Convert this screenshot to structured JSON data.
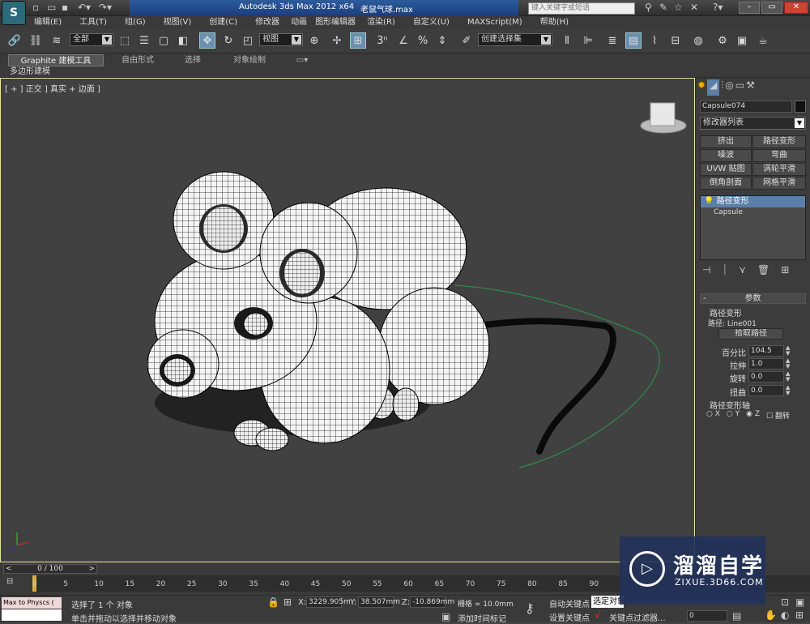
{
  "title": {
    "app": "Autodesk 3ds Max  2012 x64",
    "file": "老鼠气球.max",
    "search_placeholder": "键入关键字或短语"
  },
  "menu": [
    "编辑(E)",
    "工具(T)",
    "组(G)",
    "视图(V)",
    "创建(C)",
    "修改器",
    "动画",
    "图形编辑器",
    "渲染(R)",
    "自定义(U)",
    "MAXScript(M)",
    "帮助(H)"
  ],
  "toolbar": {
    "selection_filter": "全部",
    "ref_coord": "视图",
    "named_sel": "创建选择集",
    "snap_3": "3",
    "percent": "%"
  },
  "ribbon": {
    "tabs": [
      "Graphite 建模工具",
      "自由形式",
      "选择",
      "对象绘制"
    ],
    "sub": "多边形建模"
  },
  "viewport": {
    "label": "[ + ] 正交 ] 真实 + 边面 ]"
  },
  "panel": {
    "object_name": "Capsule074",
    "modifier_list": "修改器列表",
    "mod_buttons": [
      "挤出",
      "路径变形",
      "噪波",
      "弯曲",
      "UVW 贴图",
      "涡轮平滑",
      "倒角剖面",
      "网格平滑"
    ],
    "stack": [
      "路径变形",
      "Capsule"
    ],
    "rollout_title": "参数",
    "group1": "路径变形",
    "path_label": "路径: Line001",
    "pick_path": "拾取路径",
    "params": [
      {
        "label": "百分比",
        "value": "104.5"
      },
      {
        "label": "拉伸",
        "value": "1.0"
      },
      {
        "label": "旋转",
        "value": "0.0"
      },
      {
        "label": "扭曲",
        "value": "0.0"
      }
    ],
    "group2": "路径变形轴",
    "axes": [
      "X",
      "Y",
      "Z"
    ],
    "flip": "翻转"
  },
  "timeline": {
    "frame": "0 / 100",
    "ticks": [
      "0",
      "5",
      "10",
      "15",
      "20",
      "25",
      "30",
      "35",
      "40",
      "45",
      "50",
      "55",
      "60",
      "65",
      "70",
      "75",
      "80",
      "85",
      "90"
    ]
  },
  "status": {
    "script": "Max to Physcs (",
    "selected": "选择了 1 个 对象",
    "hint": "单击并拖动以选择并移动对象",
    "x": "3229.905m",
    "y": "38.507mm",
    "z": "-10.869mm",
    "grid": "栅格 = 10.0mm",
    "add_tag": "添加时间标记",
    "auto_key": "自动关键点",
    "set_key": "设置关键点",
    "sel_obj": "选定对象",
    "key_filter": "关键点过滤器...",
    "frame_field": "0"
  },
  "watermark": {
    "cn": "溜溜自学",
    "url": "ZIXUE.3D66.COM"
  },
  "colors": {
    "accent": "#5a7fa8",
    "viewport_border": "#e8e8a0",
    "green_path": "#2e8b4a"
  }
}
